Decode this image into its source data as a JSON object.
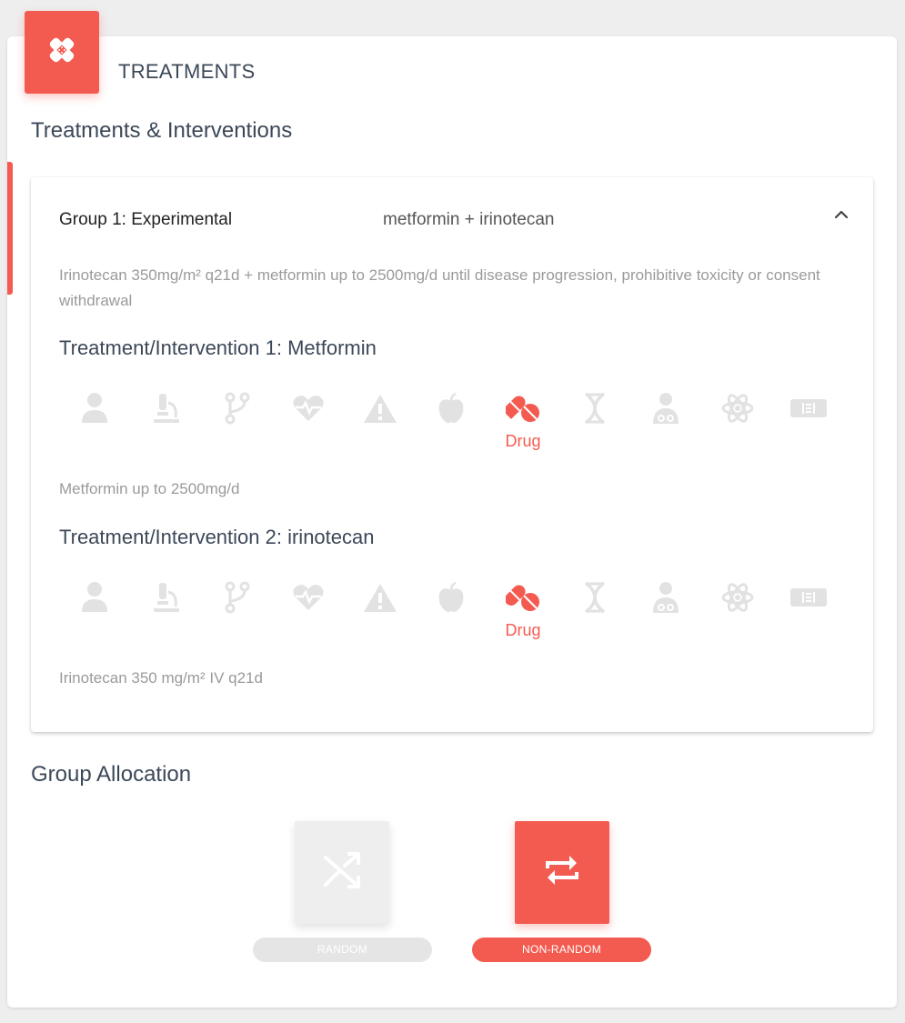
{
  "header": {
    "title": "TREATMENTS",
    "icon": "bandage-icon"
  },
  "treatments_section": {
    "title": "Treatments & Interventions"
  },
  "group": {
    "name": "Group 1: Experimental",
    "drugs": "metformin + irinotecan",
    "description": "Irinotecan 350mg/m² q21d + metformin up to 2500mg/d until disease progression, prohibitive toxicity or consent withdrawal",
    "interventions": [
      {
        "title": "Treatment/Intervention 1: Metformin",
        "selected_label": "Drug",
        "description": "Metformin up to 2500mg/d"
      },
      {
        "title": "Treatment/Intervention 2: irinotecan",
        "selected_label": "Drug",
        "description": "Irinotecan 350 mg/m² IV q21d"
      }
    ],
    "intervention_type_icons": [
      "person-icon",
      "microscope-icon",
      "branch-icon",
      "heartbeat-icon",
      "warning-icon",
      "apple-icon",
      "pills-icon",
      "dna-icon",
      "doctor-icon",
      "atom-icon",
      "film-icon"
    ]
  },
  "allocation": {
    "title": "Group Allocation",
    "random_label": "RANDOM",
    "nonrandom_label": "NON-RANDOM",
    "selected": "NON-RANDOM"
  },
  "colors": {
    "accent": "#f45b50",
    "inactive_icon": "#e2e2e2",
    "text_muted": "#9a9a9a"
  }
}
